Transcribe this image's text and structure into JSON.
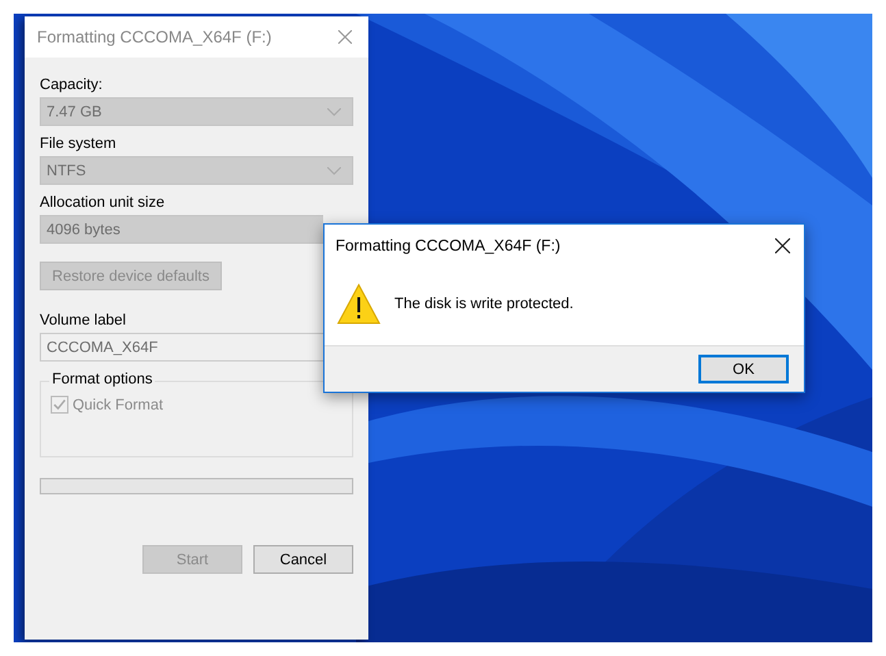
{
  "format_window": {
    "title": "Formatting CCCOMA_X64F (F:)",
    "fields": [
      {
        "label": "Capacity:",
        "value": "7.47 GB",
        "kind": "dropdown",
        "chevron": true
      },
      {
        "label": "File system",
        "value": "NTFS",
        "kind": "dropdown",
        "chevron": true
      },
      {
        "label": "Allocation unit size",
        "value": "4096 bytes",
        "kind": "dropdown",
        "chevron": false
      }
    ],
    "restore_button": {
      "label": "Restore device defaults",
      "disabled": true
    },
    "volume_label": {
      "label": "Volume label",
      "value": "CCCOMA_X64F"
    },
    "format_options": {
      "title": "Format options",
      "quick_format": {
        "label": "Quick Format",
        "checked": true,
        "disabled": true
      }
    },
    "progress": {
      "level": 0
    },
    "buttons": [
      {
        "label": "Start",
        "disabled": true
      },
      {
        "label": "Cancel",
        "disabled": false
      }
    ]
  },
  "message_box": {
    "title": "Formatting CCCOMA_X64F (F:)",
    "message": "The disk is write protected.",
    "buttons": [
      {
        "label": "OK",
        "default": true
      }
    ]
  }
}
